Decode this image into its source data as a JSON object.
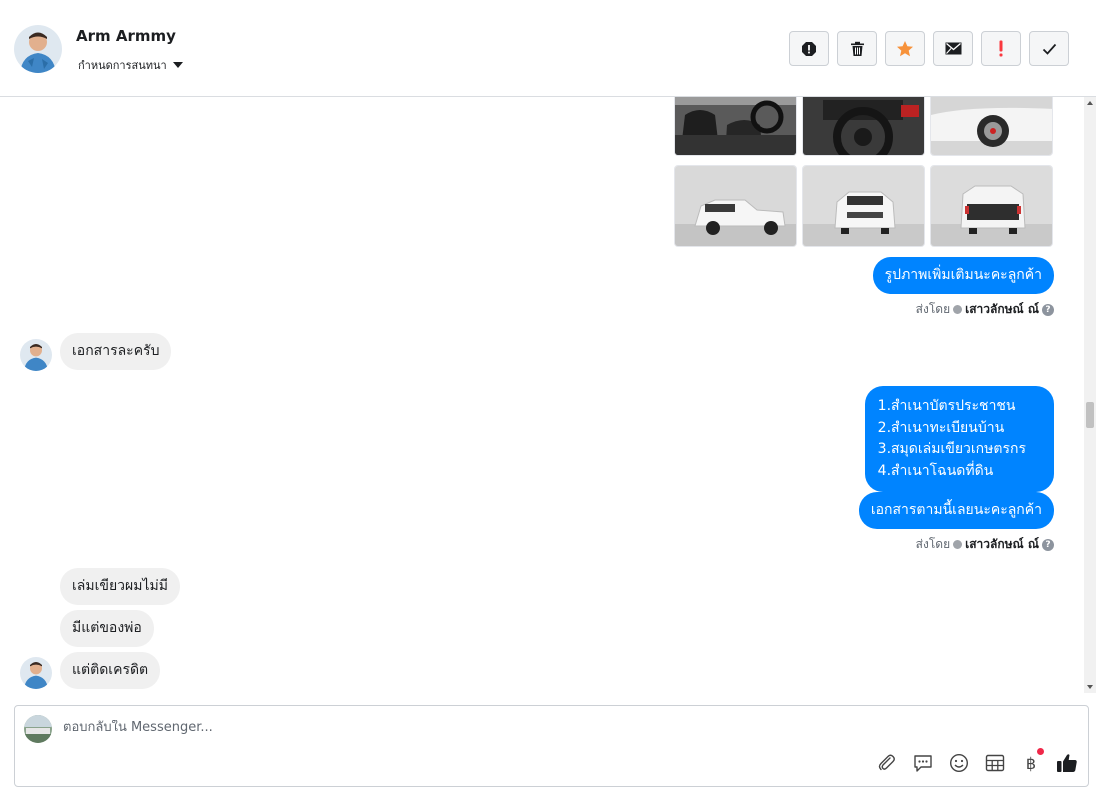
{
  "header": {
    "contact_name": "Arm Armmy",
    "conversation_settings": "กำหนดการสนทนา",
    "actions": [
      {
        "name": "report-icon",
        "label": "Report"
      },
      {
        "name": "trash-icon",
        "label": "Delete"
      },
      {
        "name": "star-icon",
        "label": "Star",
        "color": "#f7923b"
      },
      {
        "name": "mail-icon",
        "label": "Mark unread"
      },
      {
        "name": "priority-icon",
        "label": "Priority",
        "color": "#fa383e"
      },
      {
        "name": "check-icon",
        "label": "Done"
      }
    ]
  },
  "thread": {
    "photos_row1": [
      "interior-front-seats",
      "interior-steering-wheel",
      "car-side-wheel"
    ],
    "photos_row2": [
      "truck-front-angle",
      "truck-front",
      "truck-rear"
    ],
    "messages": [
      {
        "dir": "out",
        "text": "รูปภาพเพิ่มเติมนะคะลูกค้า"
      },
      {
        "dir": "meta",
        "sent_by_label": "ส่งโดย",
        "agent": "เสาวลักษณ์ ณ์"
      },
      {
        "dir": "in",
        "text": "เอกสารละครับ"
      },
      {
        "dir": "out",
        "lines": [
          "1.สำเนาบัตรประชาชน",
          "2.สำเนาทะเบียนบ้าน",
          "3.สมุดเล่มเขียวเกษตรกร",
          "4.สำเนาโฉนดที่ดิน"
        ]
      },
      {
        "dir": "out",
        "text": "เอกสารตามนี้เลยนะคะลูกค้า"
      },
      {
        "dir": "meta",
        "sent_by_label": "ส่งโดย",
        "agent": "เสาวลักษณ์ ณ์"
      },
      {
        "dir": "in",
        "text": "เล่มเขียวผมไม่มี"
      },
      {
        "dir": "in",
        "text": "มีแต่ของพ่อ"
      },
      {
        "dir": "in",
        "text": "แต่ติดเครดิต"
      }
    ]
  },
  "composer": {
    "placeholder": "ตอบกลับใน Messenger...",
    "value": "",
    "tools": [
      "paperclip-icon",
      "saved-reply-icon",
      "emoji-icon",
      "table-icon",
      "baht-icon",
      "like-icon"
    ]
  },
  "colors": {
    "outgoing_bubble": "#0084ff",
    "incoming_bubble": "#f0f0f0",
    "accent_star": "#f7923b",
    "priority_red": "#fa383e"
  }
}
